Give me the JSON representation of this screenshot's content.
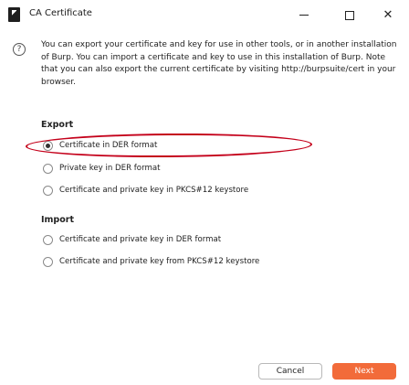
{
  "window": {
    "title": "CA Certificate",
    "icon": "burp-suite-app-icon",
    "controls": [
      "minimize-icon",
      "maximize-icon",
      "close-icon"
    ],
    "close_glyph": "✕"
  },
  "info": {
    "icon": "question-mark-icon",
    "icon_glyph": "?",
    "text": "You can export your certificate and key for use in other tools, or in another installation of Burp. You can import a certificate and key to use in this installation of Burp. Note that you can also export the current certificate by visiting http://burpsuite/cert in your browser."
  },
  "export": {
    "label": "Export",
    "options": [
      {
        "label": "Certificate in DER format",
        "selected": true
      },
      {
        "label": "Private key in DER format",
        "selected": false
      },
      {
        "label": "Certificate and private key in PKCS#12 keystore",
        "selected": false
      }
    ]
  },
  "import": {
    "label": "Import",
    "options": [
      {
        "label": "Certificate and private key in DER format",
        "selected": false
      },
      {
        "label": "Certificate and private key from PKCS#12 keystore",
        "selected": false
      }
    ]
  },
  "annotation": {
    "color": "#c4001a"
  },
  "buttons": {
    "cancel_label": "Cancel",
    "next_label": "Next",
    "accent_color": "#f26b3a"
  }
}
